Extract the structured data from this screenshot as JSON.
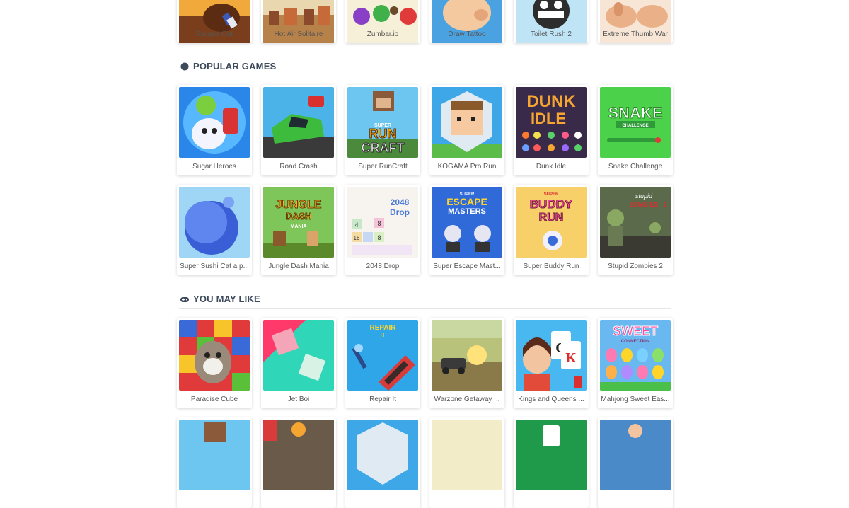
{
  "sections": {
    "top_row": [
      {
        "title": "Escape Out"
      },
      {
        "title": "Hot Air Solitaire"
      },
      {
        "title": "Zumbar.io"
      },
      {
        "title": "Draw Tattoo"
      },
      {
        "title": "Toilet Rush 2"
      },
      {
        "title": "Extreme Thumb War"
      }
    ],
    "popular": {
      "heading": "POPULAR GAMES",
      "icon": "circle-icon",
      "games": [
        {
          "title": "Sugar Heroes"
        },
        {
          "title": "Road Crash"
        },
        {
          "title": "Super RunCraft"
        },
        {
          "title": "KOGAMA Pro Run"
        },
        {
          "title": "Dunk Idle"
        },
        {
          "title": "Snake Challenge"
        },
        {
          "title": "Super Sushi Cat a p..."
        },
        {
          "title": "Jungle Dash Mania"
        },
        {
          "title": "2048 Drop"
        },
        {
          "title": "Super Escape Mast..."
        },
        {
          "title": "Super Buddy Run"
        },
        {
          "title": "Stupid Zombies 2"
        }
      ]
    },
    "you_may_like": {
      "heading": "YOU MAY LIKE",
      "icon": "gamepad-icon",
      "games": [
        {
          "title": "Paradise Cube"
        },
        {
          "title": "Jet Boi"
        },
        {
          "title": "Repair It"
        },
        {
          "title": "Warzone Getaway ..."
        },
        {
          "title": "Kings and Queens ..."
        },
        {
          "title": "Mahjong Sweet Eas..."
        }
      ]
    }
  },
  "thumb_text": {
    "runcraft": [
      "SUPER",
      "RUN",
      "CRAFT"
    ],
    "dunk_idle": [
      "DUNK",
      "IDLE"
    ],
    "snake": [
      "SNAKE",
      "CHALLENGE"
    ],
    "jungle": [
      "JUNGLE",
      "DASH",
      "MANIA"
    ],
    "drop2048": [
      "2048",
      "Drop",
      "4",
      "8",
      "16",
      "8"
    ],
    "escape_masters": [
      "SUPER",
      "ESCAPE",
      "MASTERS"
    ],
    "buddy_run": [
      "SUPER",
      "BUDDY",
      "RUN"
    ],
    "zombies": [
      "stupid",
      "ZOMBIES",
      "2"
    ],
    "repair_it": [
      "REPAIR",
      "IT"
    ],
    "kings_queens": [
      "Q",
      "K"
    ],
    "sweet": [
      "SWEET",
      "CONNECTION"
    ]
  }
}
